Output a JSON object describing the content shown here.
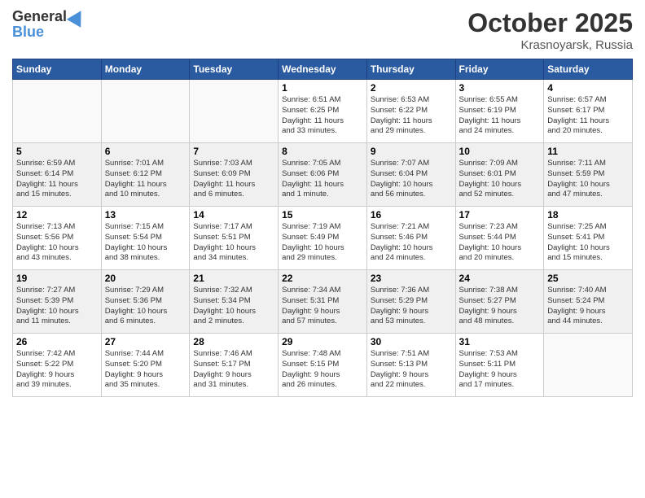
{
  "header": {
    "logo_general": "General",
    "logo_blue": "Blue",
    "title": "October 2025",
    "location": "Krasnoyarsk, Russia"
  },
  "weekdays": [
    "Sunday",
    "Monday",
    "Tuesday",
    "Wednesday",
    "Thursday",
    "Friday",
    "Saturday"
  ],
  "weeks": [
    [
      {
        "day": "",
        "content": ""
      },
      {
        "day": "",
        "content": ""
      },
      {
        "day": "",
        "content": ""
      },
      {
        "day": "1",
        "content": "Sunrise: 6:51 AM\nSunset: 6:25 PM\nDaylight: 11 hours\nand 33 minutes."
      },
      {
        "day": "2",
        "content": "Sunrise: 6:53 AM\nSunset: 6:22 PM\nDaylight: 11 hours\nand 29 minutes."
      },
      {
        "day": "3",
        "content": "Sunrise: 6:55 AM\nSunset: 6:19 PM\nDaylight: 11 hours\nand 24 minutes."
      },
      {
        "day": "4",
        "content": "Sunrise: 6:57 AM\nSunset: 6:17 PM\nDaylight: 11 hours\nand 20 minutes."
      }
    ],
    [
      {
        "day": "5",
        "content": "Sunrise: 6:59 AM\nSunset: 6:14 PM\nDaylight: 11 hours\nand 15 minutes."
      },
      {
        "day": "6",
        "content": "Sunrise: 7:01 AM\nSunset: 6:12 PM\nDaylight: 11 hours\nand 10 minutes."
      },
      {
        "day": "7",
        "content": "Sunrise: 7:03 AM\nSunset: 6:09 PM\nDaylight: 11 hours\nand 6 minutes."
      },
      {
        "day": "8",
        "content": "Sunrise: 7:05 AM\nSunset: 6:06 PM\nDaylight: 11 hours\nand 1 minute."
      },
      {
        "day": "9",
        "content": "Sunrise: 7:07 AM\nSunset: 6:04 PM\nDaylight: 10 hours\nand 56 minutes."
      },
      {
        "day": "10",
        "content": "Sunrise: 7:09 AM\nSunset: 6:01 PM\nDaylight: 10 hours\nand 52 minutes."
      },
      {
        "day": "11",
        "content": "Sunrise: 7:11 AM\nSunset: 5:59 PM\nDaylight: 10 hours\nand 47 minutes."
      }
    ],
    [
      {
        "day": "12",
        "content": "Sunrise: 7:13 AM\nSunset: 5:56 PM\nDaylight: 10 hours\nand 43 minutes."
      },
      {
        "day": "13",
        "content": "Sunrise: 7:15 AM\nSunset: 5:54 PM\nDaylight: 10 hours\nand 38 minutes."
      },
      {
        "day": "14",
        "content": "Sunrise: 7:17 AM\nSunset: 5:51 PM\nDaylight: 10 hours\nand 34 minutes."
      },
      {
        "day": "15",
        "content": "Sunrise: 7:19 AM\nSunset: 5:49 PM\nDaylight: 10 hours\nand 29 minutes."
      },
      {
        "day": "16",
        "content": "Sunrise: 7:21 AM\nSunset: 5:46 PM\nDaylight: 10 hours\nand 24 minutes."
      },
      {
        "day": "17",
        "content": "Sunrise: 7:23 AM\nSunset: 5:44 PM\nDaylight: 10 hours\nand 20 minutes."
      },
      {
        "day": "18",
        "content": "Sunrise: 7:25 AM\nSunset: 5:41 PM\nDaylight: 10 hours\nand 15 minutes."
      }
    ],
    [
      {
        "day": "19",
        "content": "Sunrise: 7:27 AM\nSunset: 5:39 PM\nDaylight: 10 hours\nand 11 minutes."
      },
      {
        "day": "20",
        "content": "Sunrise: 7:29 AM\nSunset: 5:36 PM\nDaylight: 10 hours\nand 6 minutes."
      },
      {
        "day": "21",
        "content": "Sunrise: 7:32 AM\nSunset: 5:34 PM\nDaylight: 10 hours\nand 2 minutes."
      },
      {
        "day": "22",
        "content": "Sunrise: 7:34 AM\nSunset: 5:31 PM\nDaylight: 9 hours\nand 57 minutes."
      },
      {
        "day": "23",
        "content": "Sunrise: 7:36 AM\nSunset: 5:29 PM\nDaylight: 9 hours\nand 53 minutes."
      },
      {
        "day": "24",
        "content": "Sunrise: 7:38 AM\nSunset: 5:27 PM\nDaylight: 9 hours\nand 48 minutes."
      },
      {
        "day": "25",
        "content": "Sunrise: 7:40 AM\nSunset: 5:24 PM\nDaylight: 9 hours\nand 44 minutes."
      }
    ],
    [
      {
        "day": "26",
        "content": "Sunrise: 7:42 AM\nSunset: 5:22 PM\nDaylight: 9 hours\nand 39 minutes."
      },
      {
        "day": "27",
        "content": "Sunrise: 7:44 AM\nSunset: 5:20 PM\nDaylight: 9 hours\nand 35 minutes."
      },
      {
        "day": "28",
        "content": "Sunrise: 7:46 AM\nSunset: 5:17 PM\nDaylight: 9 hours\nand 31 minutes."
      },
      {
        "day": "29",
        "content": "Sunrise: 7:48 AM\nSunset: 5:15 PM\nDaylight: 9 hours\nand 26 minutes."
      },
      {
        "day": "30",
        "content": "Sunrise: 7:51 AM\nSunset: 5:13 PM\nDaylight: 9 hours\nand 22 minutes."
      },
      {
        "day": "31",
        "content": "Sunrise: 7:53 AM\nSunset: 5:11 PM\nDaylight: 9 hours\nand 17 minutes."
      },
      {
        "day": "",
        "content": ""
      }
    ]
  ]
}
